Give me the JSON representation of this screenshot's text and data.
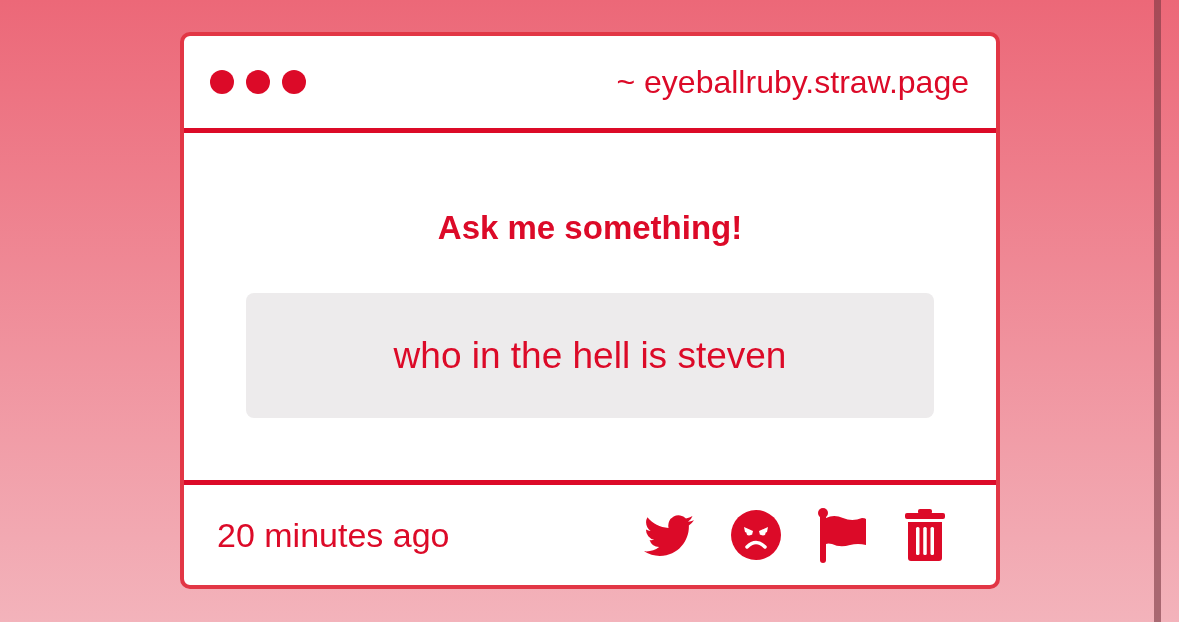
{
  "window": {
    "title": "~ eyeballruby.straw.page"
  },
  "heading": "Ask me something!",
  "question": "who in the hell is steven",
  "footer": {
    "time": "20 minutes ago"
  }
}
